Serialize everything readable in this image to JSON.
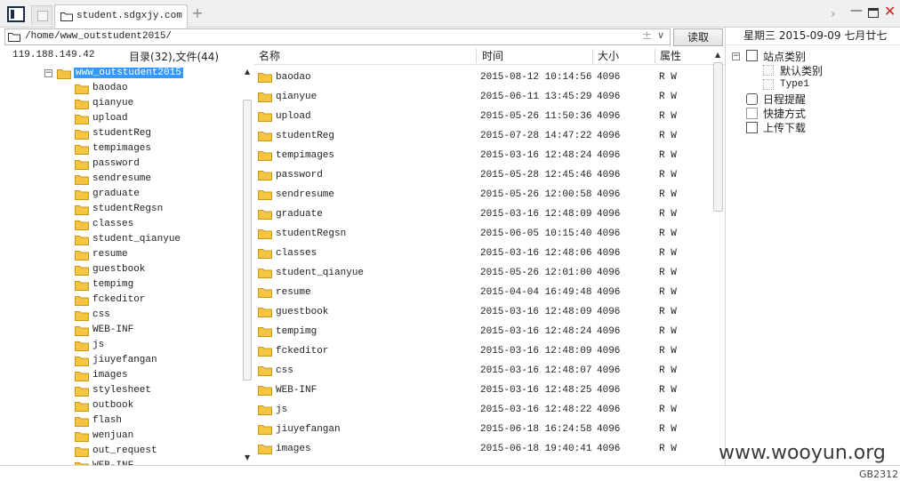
{
  "tabs": {
    "active_tab_label": "student.sdgxjy.com",
    "add_tab": "+"
  },
  "address": {
    "path": "/home/www_outstudent2015/",
    "read_label": "读取"
  },
  "status": {
    "ip": "119.188.149.42",
    "counts": "目录(32),文件(44)"
  },
  "columns": {
    "name": "名称",
    "time": "时间",
    "size": "大小",
    "attr": "属性"
  },
  "tree": {
    "root": "www_outstudent2015",
    "items": [
      "baodao",
      "qianyue",
      "upload",
      "studentReg",
      "tempimages",
      "password",
      "sendresume",
      "graduate",
      "studentRegsn",
      "classes",
      "student_qianyue",
      "resume",
      "guestbook",
      "tempimg",
      "fckeditor",
      "css",
      "WEB-INF",
      "js",
      "jiuyefangan",
      "images",
      "stylesheet",
      "outbook",
      "flash",
      "wenjuan",
      "out_request",
      "WEB-INF"
    ]
  },
  "files": [
    {
      "name": "baodao",
      "time": "2015-08-12 10:14:56",
      "size": "4096",
      "attr": "R W"
    },
    {
      "name": "qianyue",
      "time": "2015-06-11 13:45:29",
      "size": "4096",
      "attr": "R W"
    },
    {
      "name": "upload",
      "time": "2015-05-26 11:50:36",
      "size": "4096",
      "attr": "R W"
    },
    {
      "name": "studentReg",
      "time": "2015-07-28 14:47:22",
      "size": "4096",
      "attr": "R W"
    },
    {
      "name": "tempimages",
      "time": "2015-03-16 12:48:24",
      "size": "4096",
      "attr": "R W"
    },
    {
      "name": "password",
      "time": "2015-05-28 12:45:46",
      "size": "4096",
      "attr": "R W"
    },
    {
      "name": "sendresume",
      "time": "2015-05-26 12:00:58",
      "size": "4096",
      "attr": "R W"
    },
    {
      "name": "graduate",
      "time": "2015-03-16 12:48:09",
      "size": "4096",
      "attr": "R W"
    },
    {
      "name": "studentRegsn",
      "time": "2015-06-05 10:15:40",
      "size": "4096",
      "attr": "R W"
    },
    {
      "name": "classes",
      "time": "2015-03-16 12:48:06",
      "size": "4096",
      "attr": "R W"
    },
    {
      "name": "student_qianyue",
      "time": "2015-05-26 12:01:00",
      "size": "4096",
      "attr": "R W"
    },
    {
      "name": "resume",
      "time": "2015-04-04 16:49:48",
      "size": "4096",
      "attr": "R W"
    },
    {
      "name": "guestbook",
      "time": "2015-03-16 12:48:09",
      "size": "4096",
      "attr": "R W"
    },
    {
      "name": "tempimg",
      "time": "2015-03-16 12:48:24",
      "size": "4096",
      "attr": "R W"
    },
    {
      "name": "fckeditor",
      "time": "2015-03-16 12:48:09",
      "size": "4096",
      "attr": "R W"
    },
    {
      "name": "css",
      "time": "2015-03-16 12:48:07",
      "size": "4096",
      "attr": "R W"
    },
    {
      "name": "WEB-INF",
      "time": "2015-03-16 12:48:25",
      "size": "4096",
      "attr": "R W"
    },
    {
      "name": "js",
      "time": "2015-03-16 12:48:22",
      "size": "4096",
      "attr": "R W"
    },
    {
      "name": "jiuyefangan",
      "time": "2015-06-18 16:24:58",
      "size": "4096",
      "attr": "R W"
    },
    {
      "name": "images",
      "time": "2015-06-18 19:40:41",
      "size": "4096",
      "attr": "R W"
    }
  ],
  "right_panel": {
    "date": "星期三  2015-09-09  七月廿七",
    "site_category": "站点类别",
    "default_category": "默认类别",
    "type1": "Type1",
    "schedule": "日程提醒",
    "shortcut": "快捷方式",
    "upload_download": "上传下载"
  },
  "footer": {
    "watermark": "www.wooyun.org",
    "encoding": "GB2312"
  },
  "icons": [
    "panel-toggle-icon",
    "folder-icon",
    "plus-icon",
    "chevron-right-icon",
    "minimize-icon",
    "maximize-icon",
    "close-icon",
    "dropdown-icon",
    "collapse-icon"
  ],
  "colors": {
    "folder": "#f5c542",
    "selection": "#3399ff",
    "close": "#d4201b"
  }
}
